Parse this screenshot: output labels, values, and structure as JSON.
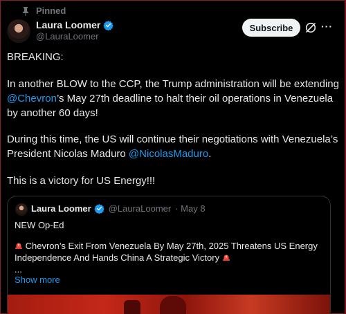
{
  "colors": {
    "accent": "#1d9bf0",
    "background": "#000000",
    "text": "#e7e9ea",
    "muted": "#71767b",
    "verified": "#1d9bf0"
  },
  "header": {
    "pinned_label": "Pinned",
    "author_name": "Laura Loomer",
    "author_handle": "@LauraLoomer",
    "subscribe_label": "Subscribe",
    "more_label": "···"
  },
  "post": {
    "line1": "BREAKING:",
    "p2_a": "In another BLOW to the CCP, the Trump administration will be extending ",
    "p2_link": "@Chevron",
    "p2_b": "’s May 27th deadline to halt their oil operations in Venezuela by another 60 days!",
    "p3_a": "During this time, the US will continue their negotiations with Venezuela’s President Nicolas Maduro ",
    "p3_link": "@NicolasMaduro",
    "p3_b": ".",
    "p4": "This is a victory for US Energy!!!"
  },
  "quote": {
    "author_name": "Laura Loomer",
    "author_handle": "@LauraLoomer",
    "date": "· May 8",
    "line1": "NEW Op-Ed",
    "line2": "Chevron’s Exit From Venezuela By May 27th, 2025 Threatens US Energy Independence And Hands China A Strategic Victory",
    "ellipsis": "...",
    "show_more": "Show more"
  },
  "icons": [
    "pin-icon",
    "verified-badge-icon",
    "grok-icon",
    "more-icon",
    "alarm-icon"
  ]
}
